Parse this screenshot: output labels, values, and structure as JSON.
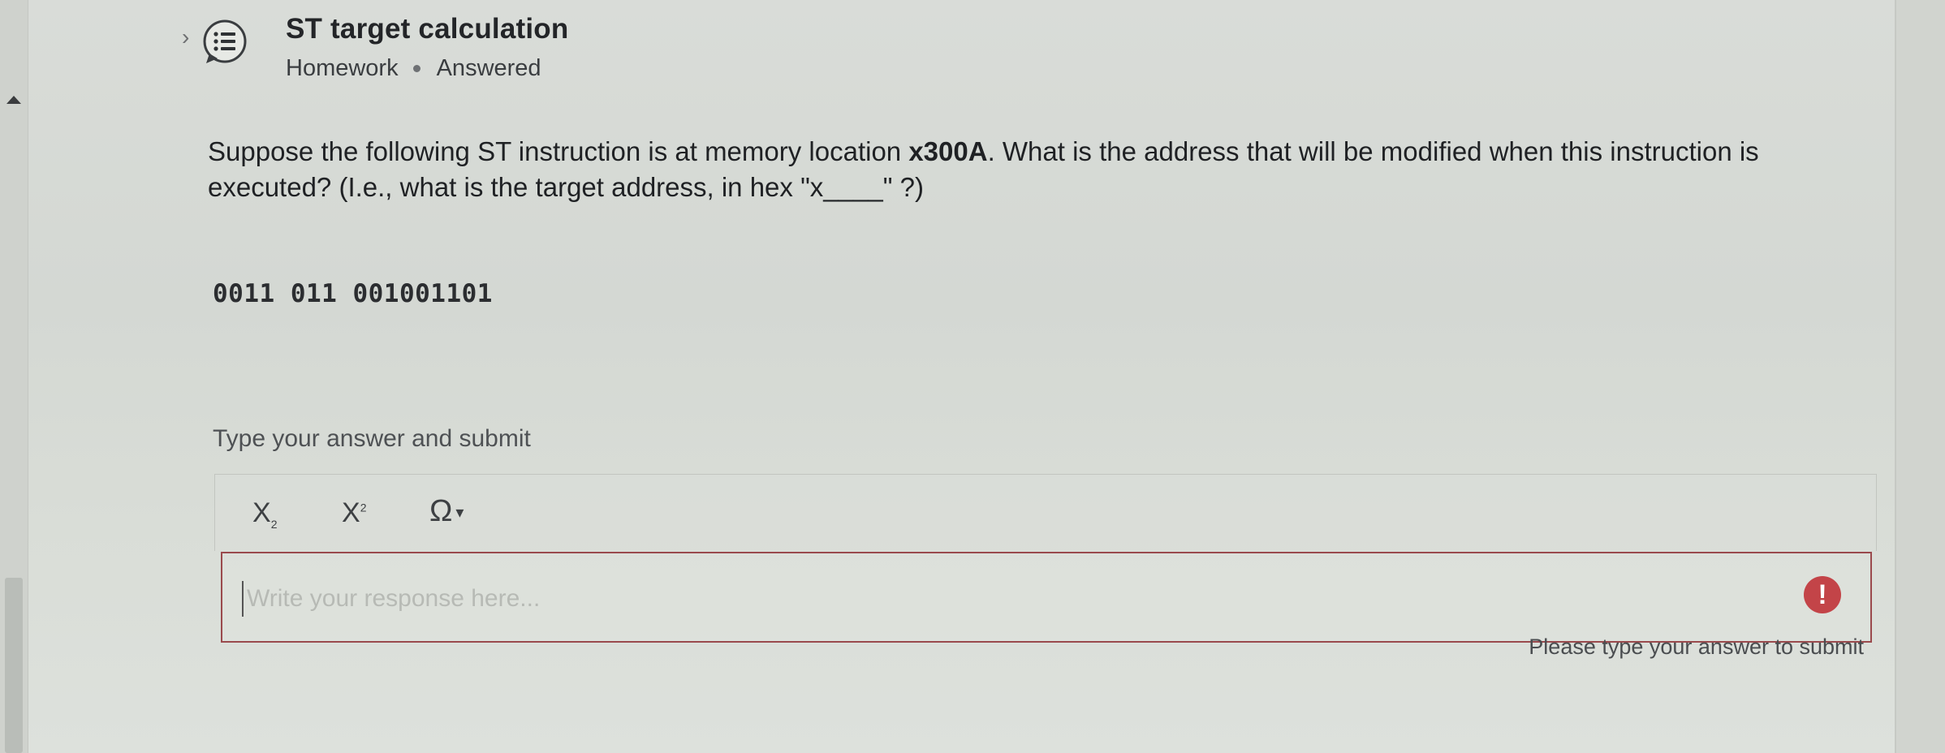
{
  "header": {
    "title": "ST target calculation",
    "category": "Homework",
    "status": "Answered"
  },
  "question": {
    "text_before": "Suppose the following ST instruction is at memory location ",
    "address": "x300A",
    "text_after": ". What is the address that will be modified when this instruction is executed? (I.e., what is the target address, in hex \"x____\" ?)",
    "code": "0011 011 001001101"
  },
  "answer": {
    "label": "Type your answer and submit",
    "placeholder": "Write your response here...",
    "value": "",
    "error_message": "Please type your answer to submit"
  },
  "toolbar": {
    "subscript_label": "X",
    "subscript_mark": "2",
    "superscript_label": "X",
    "superscript_mark": "2",
    "special_chars_label": "Ω",
    "special_chars_caret": "▾"
  },
  "icons": {
    "question_icon": "list-speech-bubble-icon",
    "error_icon": "exclamation-circle-icon",
    "chevron": "chevron-right-icon",
    "scroll_up": "triangle-up-icon"
  },
  "colors": {
    "error": "#c34448",
    "error_border": "#9a4a4d"
  }
}
